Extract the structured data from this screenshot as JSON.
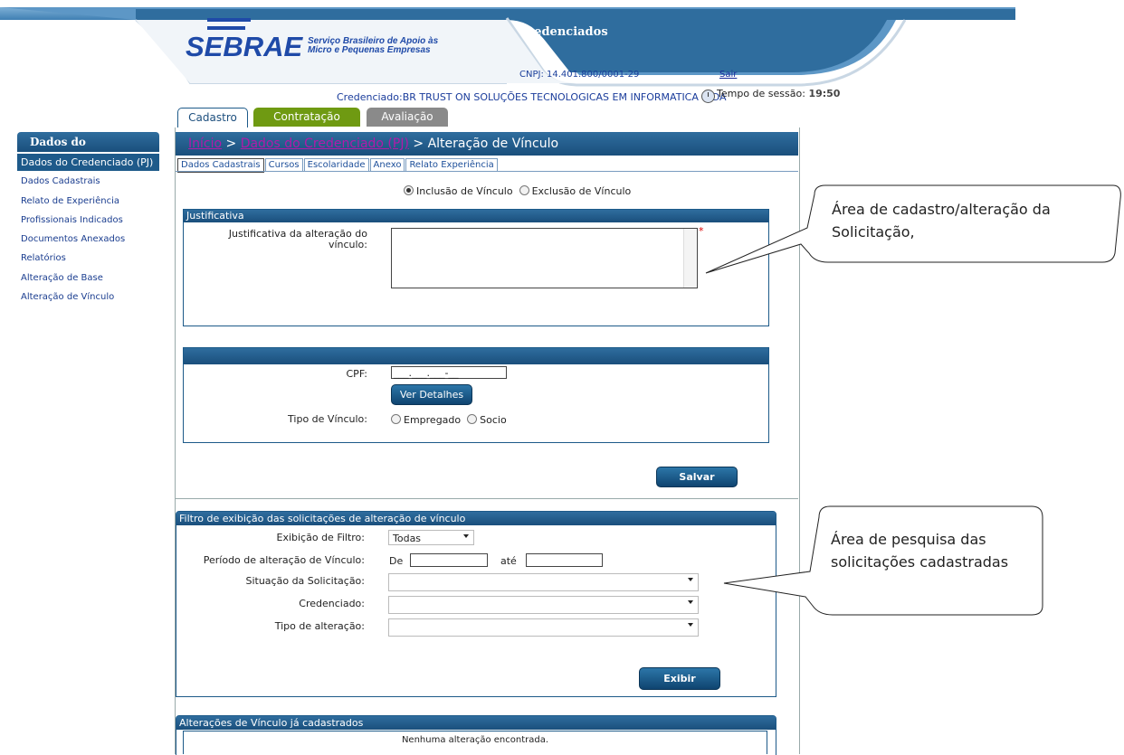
{
  "header": {
    "brand": "SEBRAE",
    "brand_sub1": "Serviço Brasileiro de Apoio às",
    "brand_sub2": "Micro e Pequenas Empresas",
    "title": "Credenciados",
    "cnpj": "CNPJ: 14.401.800/0001-29",
    "logout": "Sair",
    "credenciado": "Credenciado:BR TRUST ON SOLUÇÕES TECNOLOGICAS EM INFORMATICA LTDA",
    "session_label": "Tempo de sessão:",
    "session_value": "19:50"
  },
  "tabs": [
    "Cadastro",
    "Contratação",
    "Avaliação"
  ],
  "sidebar": {
    "title": "Dados do Credenciado",
    "active": "Dados do Credenciado (PJ)",
    "items": [
      "Dados Cadastrais",
      "Relato de Experiência",
      "Profissionais Indicados",
      "Documentos Anexados",
      "Relatórios",
      "Alteração de Base",
      "Alteração de Vínculo"
    ]
  },
  "breadcrumb": {
    "home": "Início",
    "sep1": " > ",
    "parent": "Dados do Credenciado (PJ)",
    "sep2": " > ",
    "current": "Alteração de Vínculo"
  },
  "subtabs": [
    "Dados Cadastrais",
    "Cursos",
    "Escolaridade",
    "Anexo",
    "Relato Experiência"
  ],
  "form": {
    "radio_inclusao": "Inclusão de Vínculo",
    "radio_exclusao": "Exclusão de Vínculo",
    "justificativa_header": "Justificativa",
    "justificativa_label1": "Justificativa da alteração do",
    "justificativa_label2": "vínculo:",
    "required_mark": "*",
    "cpf_label": "CPF:",
    "cpf_mask": "___.___.___-__",
    "ver_detalhes": "Ver Detalhes",
    "tipo_vinculo_label": "Tipo de Vínculo:",
    "tipo_empregado": "Empregado",
    "tipo_socio": "Socio",
    "salvar": "Salvar"
  },
  "filter": {
    "header": "Filtro de exibição das solicitações de alteração de vínculo",
    "exibicao_label": "Exibição de Filtro:",
    "exibicao_value": "Todas",
    "periodo_label": "Período de alteração de Vínculo:",
    "de": "De",
    "ate": "até",
    "situacao_label": "Situação da Solicitação:",
    "credenciado_label": "Credenciado:",
    "tipo_label": "Tipo de alteração:",
    "exibir": "Exibir"
  },
  "results": {
    "header": "Alterações de Vínculo já cadastrados",
    "empty": "Nenhuma alteração encontrada."
  },
  "callouts": {
    "c1_line1": "Área de cadastro/alteração da",
    "c1_line2": "Solicitação,",
    "c2_line1": "Área de pesquisa das",
    "c2_line2": "solicitações cadastradas"
  },
  "colors": {
    "header_blue": "#1a4f7c",
    "tab_green": "#6f9a12",
    "tab_gray": "#8a8a8a",
    "link_purple": "#b21aa8"
  }
}
